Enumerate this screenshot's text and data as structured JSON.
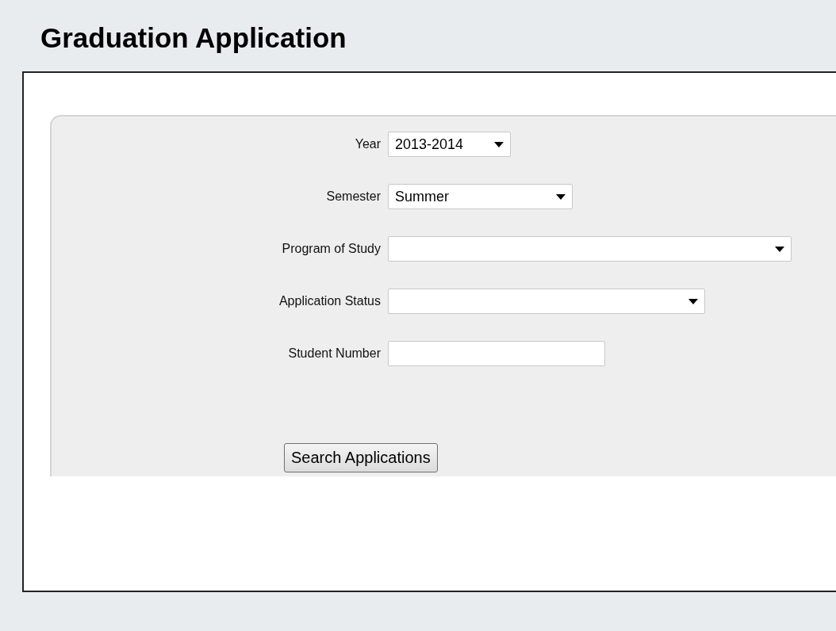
{
  "title": "Graduation Application",
  "fields": [
    {
      "label": "Year",
      "kind": "select",
      "value": "2013-2014"
    },
    {
      "label": "Semester",
      "kind": "select",
      "value": "Summer"
    },
    {
      "label": "Program of Study",
      "kind": "select"
    },
    {
      "label": "Application Status",
      "kind": "select"
    },
    {
      "label": "Student Number",
      "kind": "text"
    }
  ],
  "button": "Search Applications"
}
